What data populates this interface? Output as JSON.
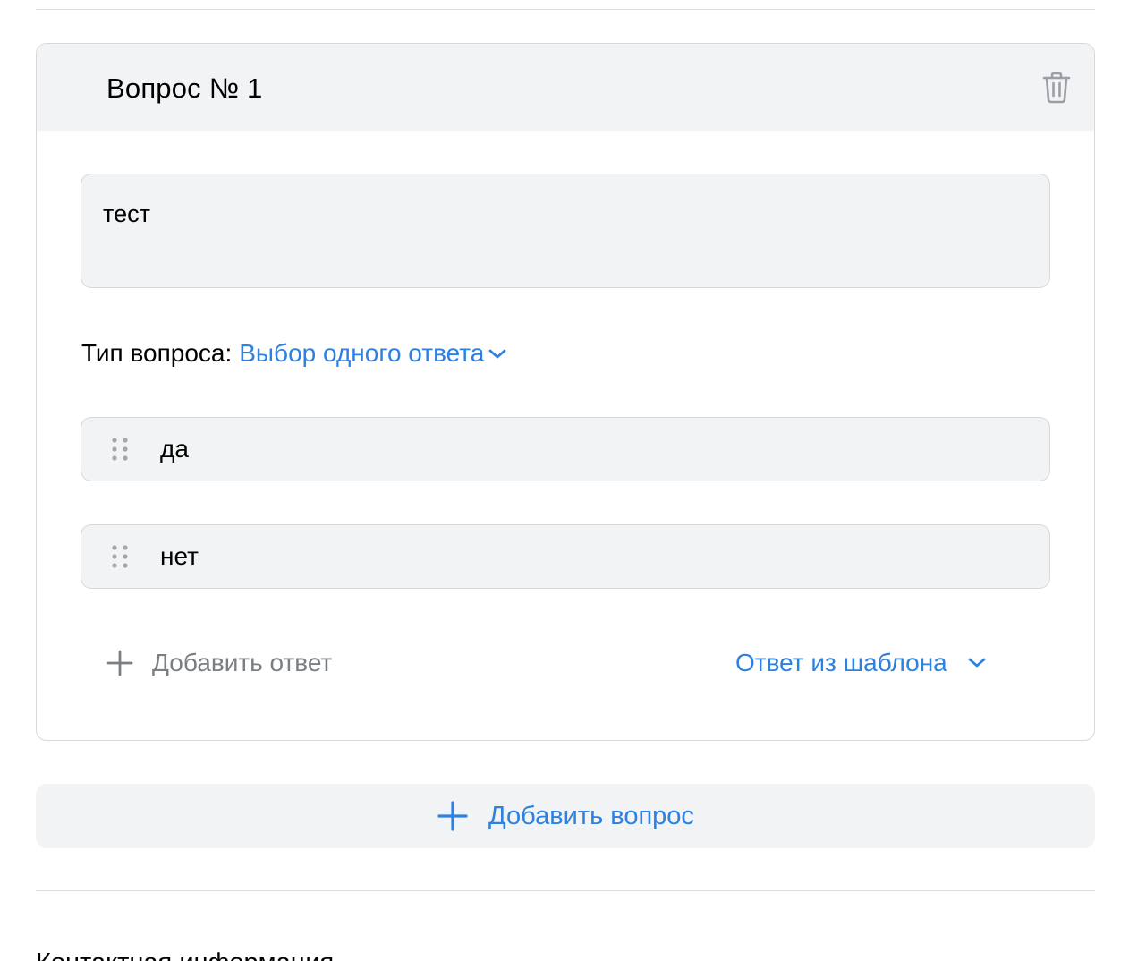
{
  "question": {
    "title": "Вопрос № 1",
    "text": "тест",
    "type_label": "Тип вопроса:",
    "type_value": "Выбор одного ответа",
    "answers": [
      {
        "text": "да"
      },
      {
        "text": "нет"
      }
    ],
    "add_answer_label": "Добавить ответ",
    "template_answer_label": "Ответ из шаблона"
  },
  "add_question_label": "Добавить вопрос",
  "next_section_title": "Контактная информация",
  "colors": {
    "accent": "#2d81e0",
    "muted": "#7b7f85",
    "surface": "#f2f3f5",
    "border": "#d6d8db"
  },
  "icons": {
    "delete": "trash-icon",
    "drag": "drag-handle-icon",
    "add": "plus-icon",
    "dropdown": "chevron-down-icon"
  }
}
